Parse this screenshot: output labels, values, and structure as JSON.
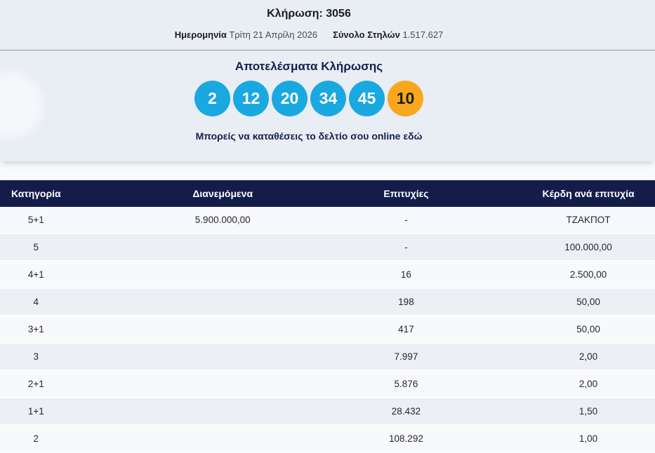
{
  "header": {
    "draw_label": "Κλήρωση: 3056",
    "date_label": "Ημερομηνία",
    "date_value": "Τρίτη 21 Απρίλη 2026",
    "columns_label": "Σύνολο Στηλών",
    "columns_value": "1.517.627"
  },
  "results": {
    "title": "Αποτελέσματα Κλήρωσης",
    "numbers": [
      "2",
      "12",
      "20",
      "34",
      "45"
    ],
    "bonus_number": "10",
    "online_link_text": "Μπορείς να καταθέσεις το δελτίο σου online εδώ"
  },
  "table": {
    "headers": [
      "Κατηγορία",
      "Διανεμόμενα",
      "Επιτυχίες",
      "Κέρδη ανά επιτυχία"
    ],
    "rows": [
      {
        "category": "5+1",
        "distributed": "5.900.000,00",
        "winners": "-",
        "prize": "ΤΖΑΚΠΟΤ"
      },
      {
        "category": "5",
        "distributed": "",
        "winners": "-",
        "prize": "100.000,00"
      },
      {
        "category": "4+1",
        "distributed": "",
        "winners": "16",
        "prize": "2.500,00"
      },
      {
        "category": "4",
        "distributed": "",
        "winners": "198",
        "prize": "50,00"
      },
      {
        "category": "3+1",
        "distributed": "",
        "winners": "417",
        "prize": "50,00"
      },
      {
        "category": "3",
        "distributed": "",
        "winners": "7.997",
        "prize": "2,00"
      },
      {
        "category": "2+1",
        "distributed": "",
        "winners": "5.876",
        "prize": "2,00"
      },
      {
        "category": "1+1",
        "distributed": "",
        "winners": "28.432",
        "prize": "1,50"
      },
      {
        "category": "2",
        "distributed": "",
        "winners": "108.292",
        "prize": "1,00"
      }
    ]
  },
  "colors": {
    "section_bg": "#e9edf4",
    "header_navy": "#141d4a",
    "ball_blue": "#1aa8e1",
    "ball_bonus_orange": "#f9a71c"
  }
}
